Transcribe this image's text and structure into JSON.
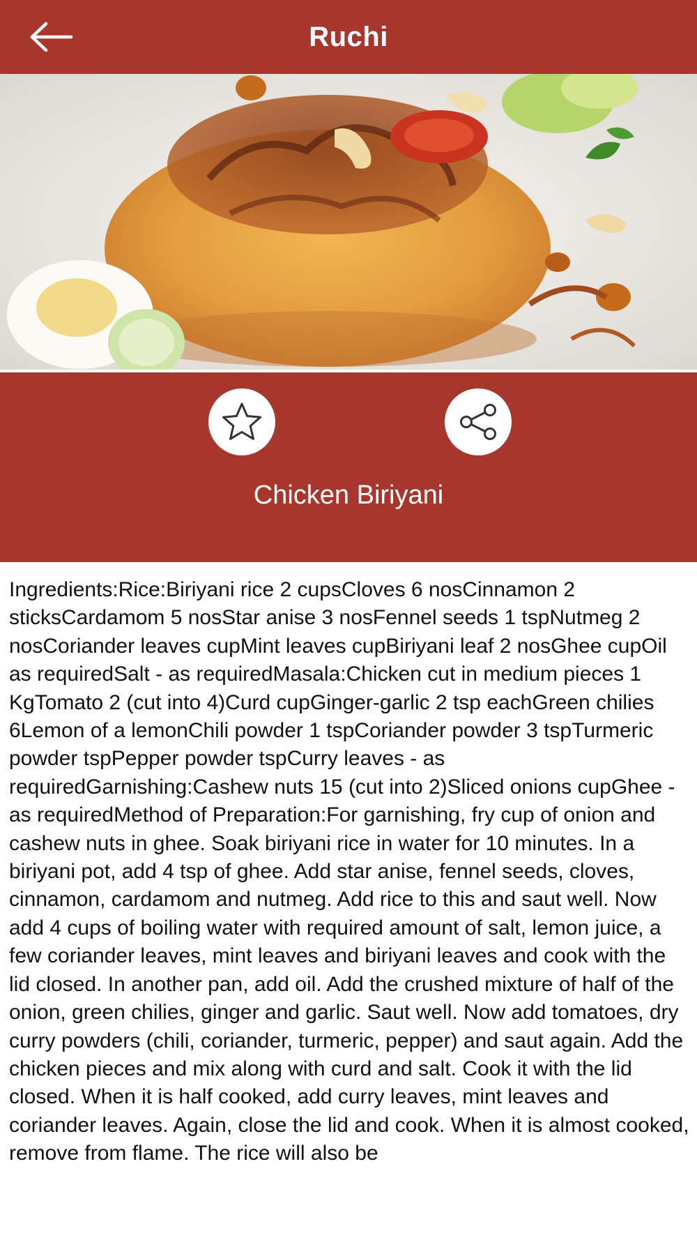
{
  "app_bar": {
    "title": "Ruchi",
    "back_icon": "arrow-left-icon"
  },
  "colors": {
    "primary": "#a7372c",
    "on_primary": "#ffffff",
    "body_text": "#111111"
  },
  "actions": {
    "favorite_icon": "star-outline-icon",
    "share_icon": "share-icon"
  },
  "recipe": {
    "title": "Chicken Biriyani",
    "body": "Ingredients:Rice:Biriyani rice  2 cupsCloves  6 nosCinnamon  2 sticksCardamom  5 nosStar anise  3 nosFennel seeds  1 tspNutmeg  2 nosCoriander leaves   cupMint leaves   cupBiriyani leaf  2 nosGhee   cupOil  as requiredSalt - as requiredMasala:Chicken cut in medium pieces  1 KgTomato  2 (cut into 4)Curd   cupGinger-garlic  2 tsp eachGreen chilies  6Lemon   of a lemonChili powder  1 tspCoriander powder  3 tspTurmeric powder   tspPepper powder   tspCurry leaves - as requiredGarnishing:Cashew nuts  15 (cut into 2)Sliced onions   cupGhee - as requiredMethod of Preparation:For garnishing, fry  cup of onion and cashew nuts in ghee. Soak biriyani rice in water for 10 minutes. In a biriyani pot, add 4 tsp of ghee. Add star anise, fennel seeds, cloves, cinnamon, cardamom and nutmeg. Add rice to this and saut well. Now add 4 cups of boiling water with required amount of salt, lemon juice, a few coriander leaves, mint leaves and biriyani leaves and cook with the lid closed. In another pan, add oil. Add the crushed mixture of half of the onion, green chilies, ginger and garlic. Saut well. Now add tomatoes, dry curry powders (chili, coriander, turmeric, pepper) and saut again. Add the chicken pieces and mix along with curd and salt. Cook it with the lid closed. When it is half cooked, add curry leaves, mint leaves and coriander leaves. Again, close the lid and cook. When it is almost cooked, remove from flame. The rice will also be"
  }
}
